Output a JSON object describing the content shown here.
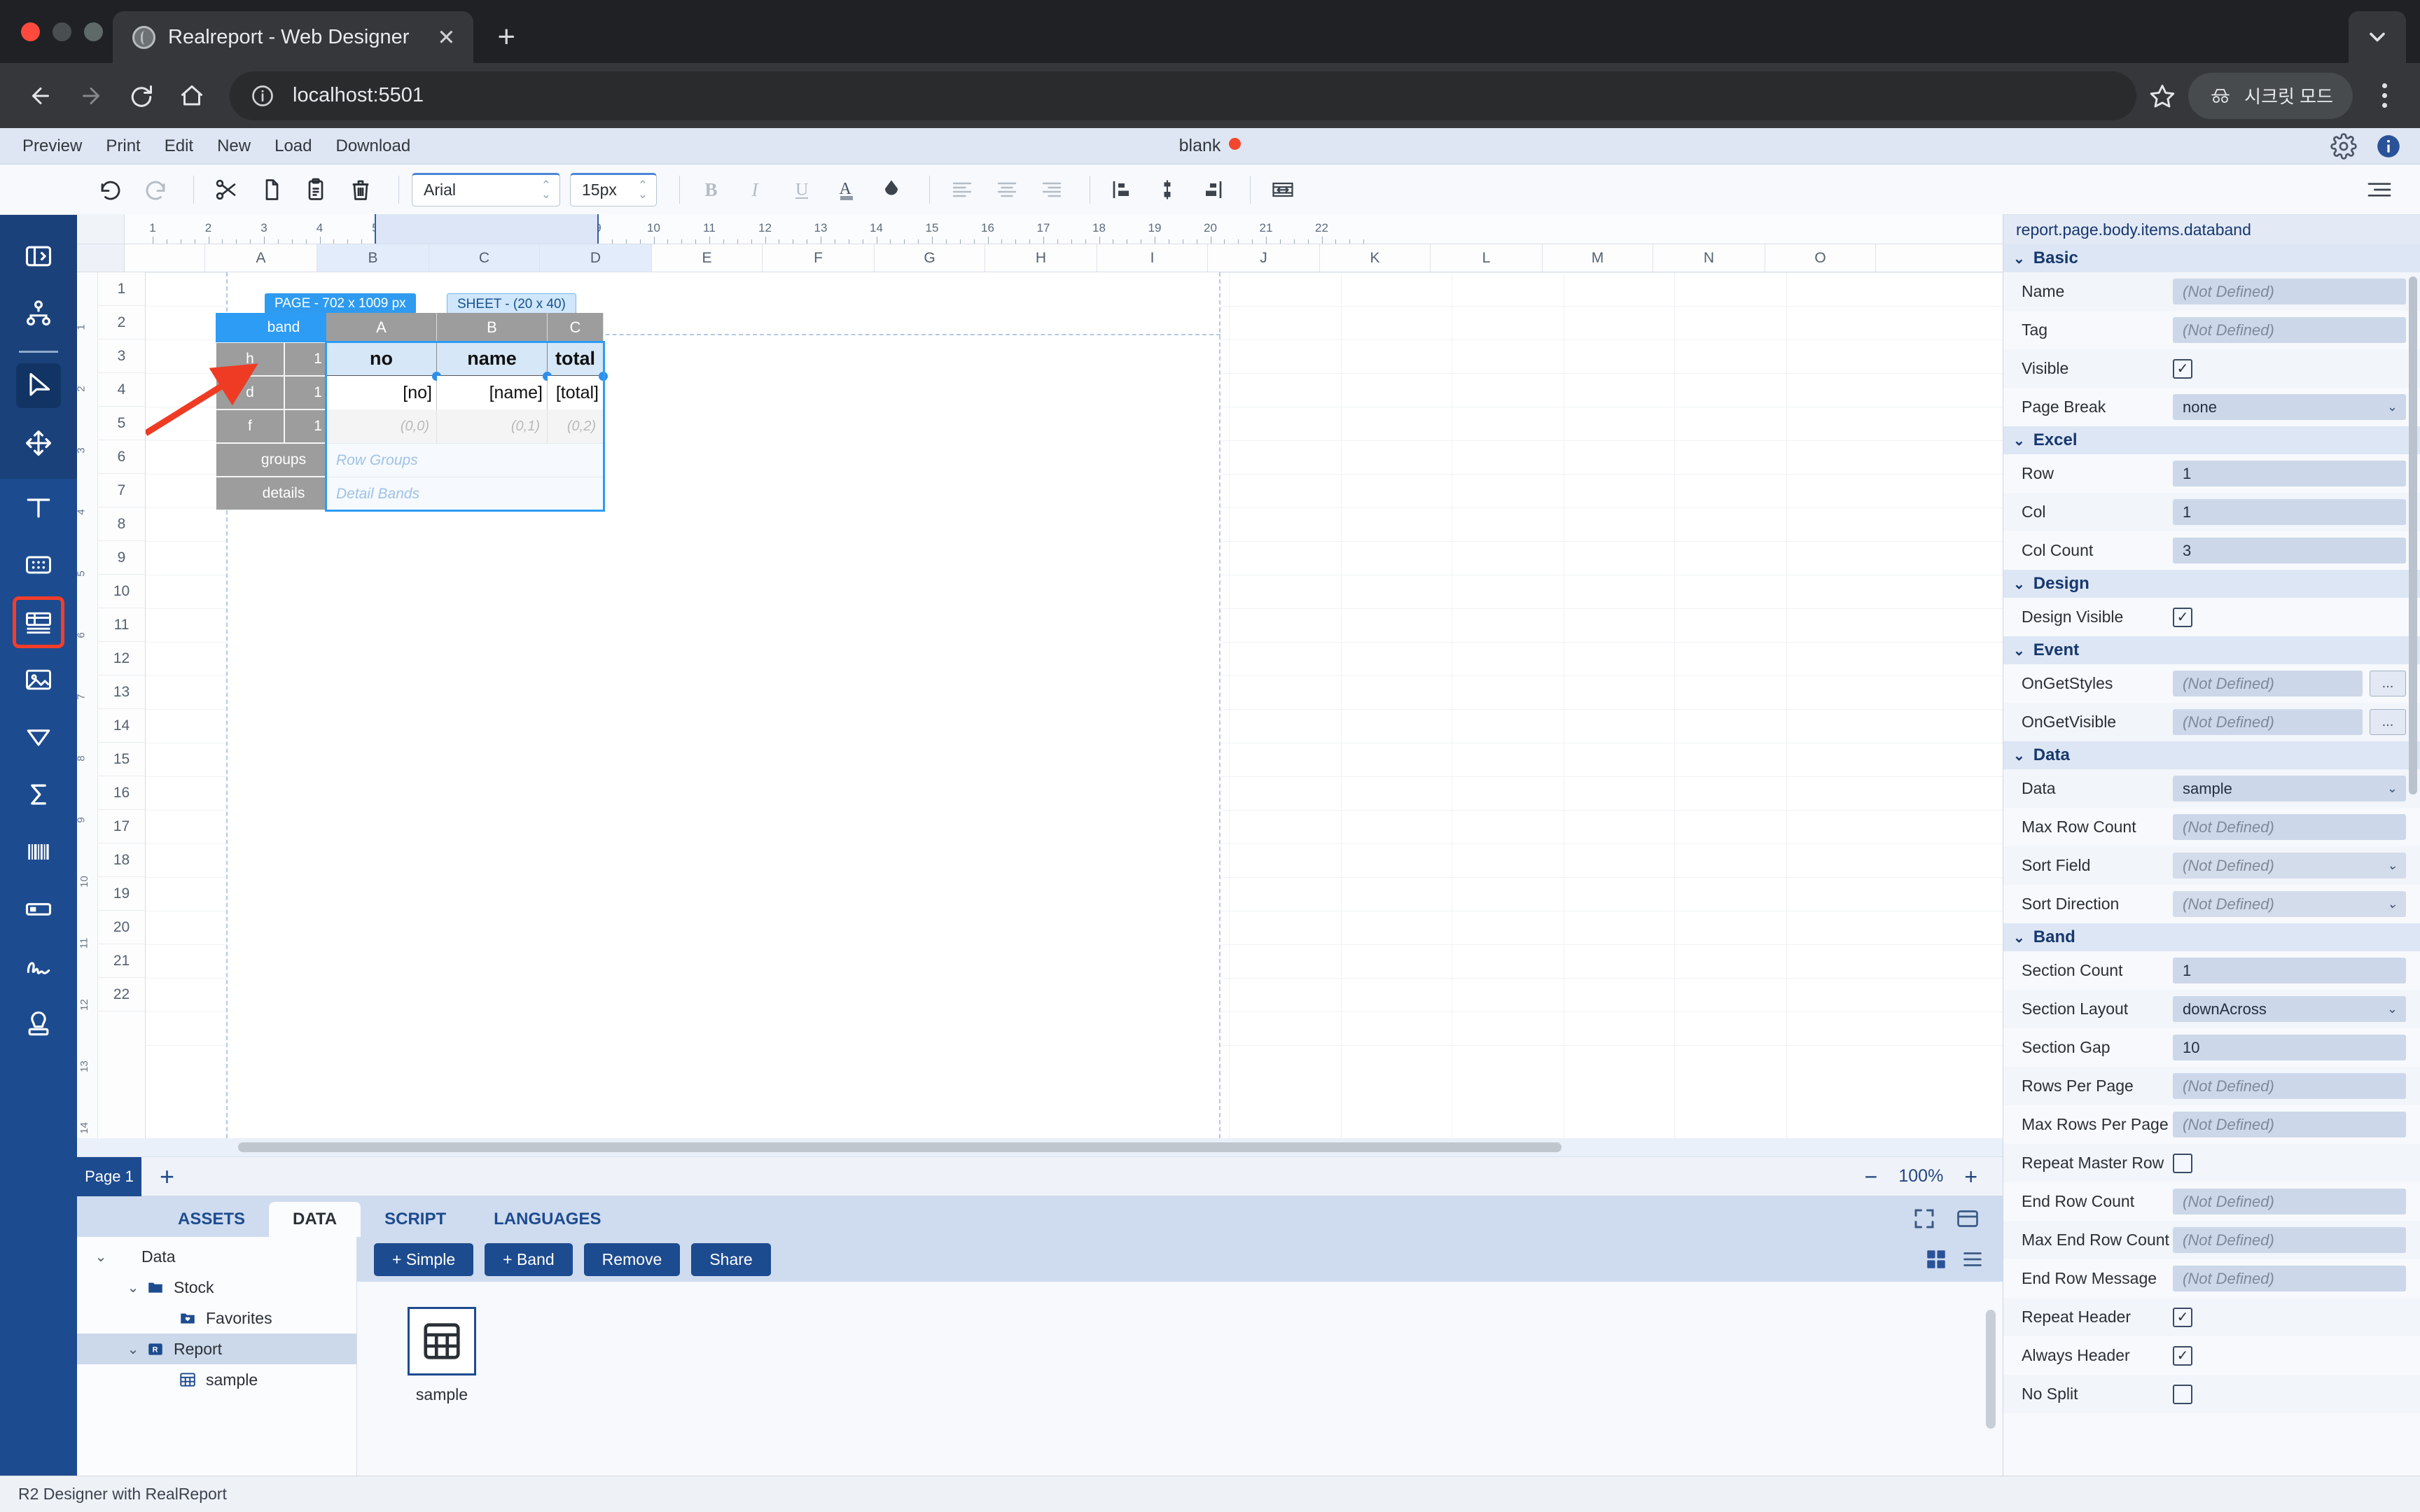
{
  "browser": {
    "tab_title": "Realreport - Web Designer",
    "url": "localhost:5501",
    "incognito_label": "시크릿 모드",
    "new_tab_label": "+",
    "close_label": "✕"
  },
  "app": {
    "menu": [
      "Preview",
      "Print",
      "Edit",
      "New",
      "Load",
      "Download"
    ],
    "doc_title": "blank",
    "status_text": "R2 Designer with RealReport"
  },
  "toolbar": {
    "font_family": "Arial",
    "font_size": "15px"
  },
  "ruler": {
    "numbers": [
      "1",
      "2",
      "3",
      "4",
      "5",
      "6",
      "7",
      "8",
      "9",
      "10",
      "11",
      "12",
      "13",
      "14",
      "15",
      "16",
      "17",
      "18",
      "19",
      "20",
      "21",
      "22"
    ]
  },
  "sheet": {
    "columns": [
      "A",
      "B",
      "C",
      "D",
      "E",
      "F",
      "G",
      "H",
      "I",
      "J",
      "K",
      "L",
      "M",
      "N",
      "O"
    ],
    "rows": [
      "1",
      "2",
      "3",
      "4",
      "5",
      "6",
      "7",
      "8",
      "9",
      "10",
      "11",
      "12",
      "13",
      "14",
      "15",
      "16",
      "17",
      "18",
      "19",
      "20",
      "21",
      "22"
    ],
    "page_badge": "PAGE - 702 x 1009 px",
    "sheet_badge": "SHEET - (20 x 40)"
  },
  "band": {
    "title": "band",
    "rows": [
      {
        "type": "h",
        "count": "1"
      },
      {
        "type": "d",
        "count": "1"
      },
      {
        "type": "f",
        "count": "1"
      }
    ],
    "groups_label": "groups",
    "details_label": "details",
    "groups_placeholder": "Row Groups",
    "details_placeholder": "Detail Bands",
    "col_headers": [
      "A",
      "B",
      "C"
    ],
    "header_cells": [
      "no",
      "name",
      "total"
    ],
    "detail_cells": [
      "[no]",
      "[name]",
      "[total]"
    ],
    "footer_cells": [
      "(0,0)",
      "(0,1)",
      "(0,2)"
    ]
  },
  "pagebar": {
    "page_tab": "Page 1",
    "add_page": "+",
    "zoom_out": "−",
    "zoom_level": "100%",
    "zoom_in": "+"
  },
  "bottom": {
    "tabs": [
      {
        "label": "ASSETS",
        "active": false
      },
      {
        "label": "DATA",
        "active": true
      },
      {
        "label": "SCRIPT",
        "active": false
      },
      {
        "label": "LANGUAGES",
        "active": false
      }
    ],
    "tree": [
      {
        "label": "Data",
        "depth": 0,
        "caret": "⌄",
        "icon": "",
        "selected": false
      },
      {
        "label": "Stock",
        "depth": 1,
        "caret": "⌄",
        "icon": "folder-icon",
        "selected": false
      },
      {
        "label": "Favorites",
        "depth": 2,
        "caret": "",
        "icon": "folder-heart-icon",
        "selected": false
      },
      {
        "label": "Report",
        "depth": 1,
        "caret": "⌄",
        "icon": "report-folder-icon",
        "selected": true
      },
      {
        "label": "sample",
        "depth": 2,
        "caret": "",
        "icon": "table-icon",
        "selected": false
      }
    ],
    "buttons": [
      "+ Simple",
      "+ Band",
      "Remove",
      "Share"
    ],
    "dataset_items": [
      {
        "label": "sample",
        "icon": "table-grid-icon"
      }
    ]
  },
  "props": {
    "path": "report.page.body.items.databand",
    "not_defined": "(Not Defined)",
    "groups": [
      {
        "title": "Basic",
        "rows": [
          {
            "label": "Name",
            "kind": "text",
            "value": "",
            "placeholder": "(Not Defined)"
          },
          {
            "label": "Tag",
            "kind": "text",
            "value": "",
            "placeholder": "(Not Defined)"
          },
          {
            "label": "Visible",
            "kind": "check",
            "checked": true
          },
          {
            "label": "Page Break",
            "kind": "combo",
            "value": "none"
          }
        ]
      },
      {
        "title": "Excel",
        "rows": [
          {
            "label": "Row",
            "kind": "text",
            "value": "1"
          },
          {
            "label": "Col",
            "kind": "text",
            "value": "1"
          },
          {
            "label": "Col Count",
            "kind": "text",
            "value": "3"
          }
        ]
      },
      {
        "title": "Design",
        "rows": [
          {
            "label": "Design Visible",
            "kind": "check",
            "checked": true
          }
        ]
      },
      {
        "title": "Event",
        "rows": [
          {
            "label": "OnGetStyles",
            "kind": "text-ellipsis",
            "value": "",
            "placeholder": "(Not Defined)",
            "ellipsis": "..."
          },
          {
            "label": "OnGetVisible",
            "kind": "text-ellipsis",
            "value": "",
            "placeholder": "(Not Defined)",
            "ellipsis": "..."
          }
        ]
      },
      {
        "title": "Data",
        "rows": [
          {
            "label": "Data",
            "kind": "combo",
            "value": "sample"
          },
          {
            "label": "Max Row Count",
            "kind": "text",
            "value": "",
            "placeholder": "(Not Defined)"
          },
          {
            "label": "Sort Field",
            "kind": "combo-disabled",
            "value": "(Not Defined)"
          },
          {
            "label": "Sort Direction",
            "kind": "combo-disabled",
            "value": "(Not Defined)"
          }
        ]
      },
      {
        "title": "Band",
        "rows": [
          {
            "label": "Section Count",
            "kind": "text",
            "value": "1"
          },
          {
            "label": "Section Layout",
            "kind": "combo",
            "value": "downAcross"
          },
          {
            "label": "Section Gap",
            "kind": "text",
            "value": "10"
          },
          {
            "label": "Rows Per Page",
            "kind": "text",
            "value": "",
            "placeholder": "(Not Defined)"
          },
          {
            "label": "Max Rows Per Page",
            "kind": "text",
            "value": "",
            "placeholder": "(Not Defined)"
          },
          {
            "label": "Repeat Master Row",
            "kind": "check",
            "checked": false
          },
          {
            "label": "End Row Count",
            "kind": "text",
            "value": "",
            "placeholder": "(Not Defined)"
          },
          {
            "label": "Max End Row Count",
            "kind": "text",
            "value": "",
            "placeholder": "(Not Defined)"
          },
          {
            "label": "End Row Message",
            "kind": "text",
            "value": "",
            "placeholder": "(Not Defined)"
          },
          {
            "label": "Repeat Header",
            "kind": "check",
            "checked": true
          },
          {
            "label": "Always Header",
            "kind": "check",
            "checked": true
          },
          {
            "label": "No Split",
            "kind": "check",
            "checked": false
          }
        ]
      }
    ]
  },
  "colors": {
    "accent": "#1d4b8f",
    "band_blue": "#2d9cf5",
    "arrow_red": "#ef3b24",
    "doc_dot": "#f2462e"
  }
}
